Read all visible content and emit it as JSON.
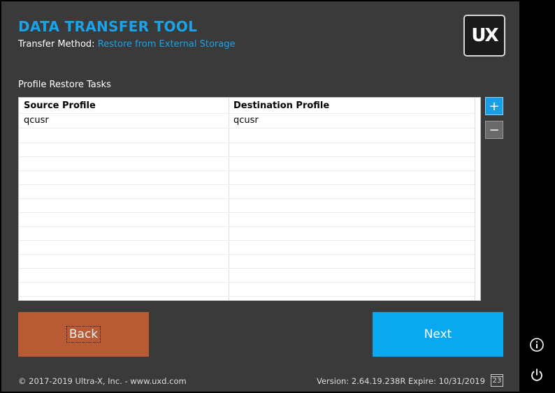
{
  "app": {
    "title": "DATA TRANSFER TOOL",
    "logo_text": "UX"
  },
  "method": {
    "label": "Transfer Method:",
    "value": "Restore from External Storage"
  },
  "tasks": {
    "label": "Profile Restore Tasks",
    "columns": [
      "Source Profile",
      "Destination Profile"
    ],
    "rows": [
      [
        "qcusr",
        "qcusr"
      ]
    ]
  },
  "buttons": {
    "add": "+",
    "remove": "−",
    "back": "Back",
    "next": "Next"
  },
  "footer": {
    "copyright": "© 2017-2019 Ultra-X, Inc. - www.uxd.com",
    "version": "Version: 2.64.19.238R Expire: 10/31/2019",
    "calendar_day": "23"
  },
  "icons": {
    "info": "info-icon",
    "power": "power-icon",
    "calendar": "calendar-icon"
  },
  "colors": {
    "accent": "#1aa3e8",
    "back": "#b85a34",
    "next": "#0aa9ef",
    "background": "#3a3a3a"
  }
}
